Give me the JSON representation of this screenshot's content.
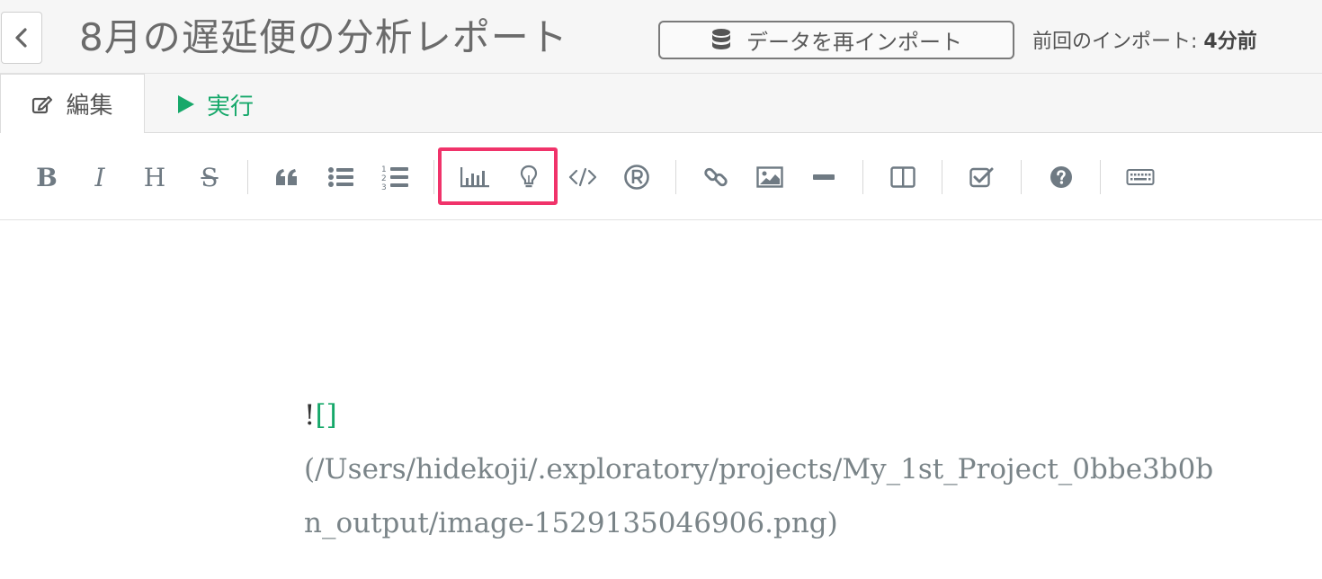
{
  "header": {
    "title": "8月の遅延便の分析レポート",
    "reimport_label": "データを再インポート",
    "last_import_label": "前回のインポート:",
    "last_import_value": "4分前"
  },
  "tabs": {
    "edit_label": "編集",
    "run_label": "実行"
  },
  "toolbar": {
    "bold": "B",
    "italic": "I",
    "heading": "H",
    "strike": "S"
  },
  "editor": {
    "bang": "!",
    "brackets": "[]",
    "line1": "(/Users/hidekoji/.exploratory/projects/My_1st_Project_0bbe3b0b",
    "line2": "n_output/image-1529135046906.png)"
  },
  "colors": {
    "accent_green": "#16a86a",
    "highlight_pink": "#f0336a",
    "icon_gray": "#6f7a83"
  }
}
